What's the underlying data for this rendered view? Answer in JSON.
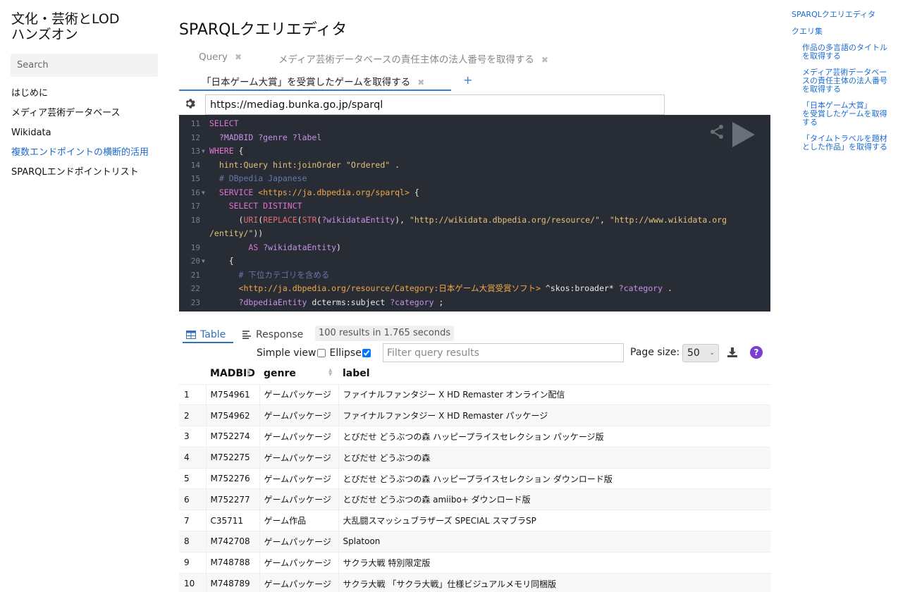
{
  "site": {
    "title_line1": "文化・芸術とLOD",
    "title_line2": "ハンズオン",
    "search_placeholder": "Search"
  },
  "sidebar": {
    "items": [
      {
        "label": "はじめに",
        "active": false
      },
      {
        "label": "メディア芸術データベース",
        "active": false
      },
      {
        "label": "Wikidata",
        "active": false
      },
      {
        "label": "複数エンドポイントの横断的活用",
        "active": true
      },
      {
        "label": "SPARQLエンドポイントリスト",
        "active": false
      }
    ]
  },
  "page": {
    "title": "SPARQLクエリエディタ"
  },
  "tabs": [
    {
      "label": "Query"
    },
    {
      "label": "メディア芸術データベースの責任主体の法人番号を取得する"
    },
    {
      "label": "「日本ゲーム大賞」を受賞したゲームを取得する"
    }
  ],
  "tab_close_glyph": "✖",
  "tab_add_glyph": "+",
  "endpoint": {
    "value": "https://mediag.bunka.go.jp/sparql"
  },
  "editor": {
    "line_numbers": [
      "11",
      "12",
      "13",
      "14",
      "15",
      "16",
      "17",
      "18",
      "",
      "19",
      "20",
      "21",
      "22",
      "23"
    ]
  },
  "results": {
    "tab_table": "Table",
    "tab_response": "Response",
    "info": "100 results in 1.765 seconds",
    "simple_view_label": "Simple view",
    "ellipse_label": "Ellipse",
    "simple_view_checked": false,
    "ellipse_checked": true,
    "filter_placeholder": "Filter query results",
    "page_size_label": "Page size:",
    "page_size_value": "50",
    "help_glyph": "?",
    "columns": [
      "MADBID",
      "genre",
      "label"
    ],
    "rows": [
      [
        "1",
        "M754961",
        "ゲームパッケージ",
        "ファイナルファンタジー X HD Remaster オンライン配信"
      ],
      [
        "2",
        "M754962",
        "ゲームパッケージ",
        "ファイナルファンタジー X HD Remaster パッケージ"
      ],
      [
        "3",
        "M752274",
        "ゲームパッケージ",
        "とびだせ どうぶつの森 ハッピープライスセレクション パッケージ版"
      ],
      [
        "4",
        "M752275",
        "ゲームパッケージ",
        "とびだせ どうぶつの森"
      ],
      [
        "5",
        "M752276",
        "ゲームパッケージ",
        "とびだせ どうぶつの森 ハッピープライスセレクション ダウンロード版"
      ],
      [
        "6",
        "M752277",
        "ゲームパッケージ",
        "とびだせ どうぶつの森 amiibo+ ダウンロード版"
      ],
      [
        "7",
        "C35711",
        "ゲーム作品",
        "大乱闘スマッシュブラザーズ SPECIAL スマブラSP"
      ],
      [
        "8",
        "M742708",
        "ゲームパッケージ",
        "Splatoon"
      ],
      [
        "9",
        "M748788",
        "ゲームパッケージ",
        "サクラ大戦 特別限定版"
      ],
      [
        "10",
        "M748789",
        "ゲームパッケージ",
        "サクラ大戦 「サクラ大戦」仕様ビジュアルメモリ同梱版"
      ]
    ]
  },
  "toc": {
    "items": [
      {
        "label": "SPARQLクエリエディタ",
        "level": 1
      },
      {
        "label": "クエリ集",
        "level": 1
      },
      {
        "lines": [
          "作品の多言語のタイトル",
          "を取得する"
        ],
        "level": 2
      },
      {
        "lines": [
          "メディア芸術データベー",
          "スの責任主体の法人番号",
          "を取得する"
        ],
        "level": 2
      },
      {
        "lines": [
          "「日本ゲーム大賞」",
          "を受賞したゲームを取得",
          "する"
        ],
        "level": 2
      },
      {
        "lines": [
          "「タイムトラベルを題材",
          "とした作品」を取得する"
        ],
        "level": 2
      }
    ]
  },
  "colors": {
    "accent": "#1a6bd1",
    "editor_bg": "#282c34",
    "help": "#7b3fd1"
  }
}
